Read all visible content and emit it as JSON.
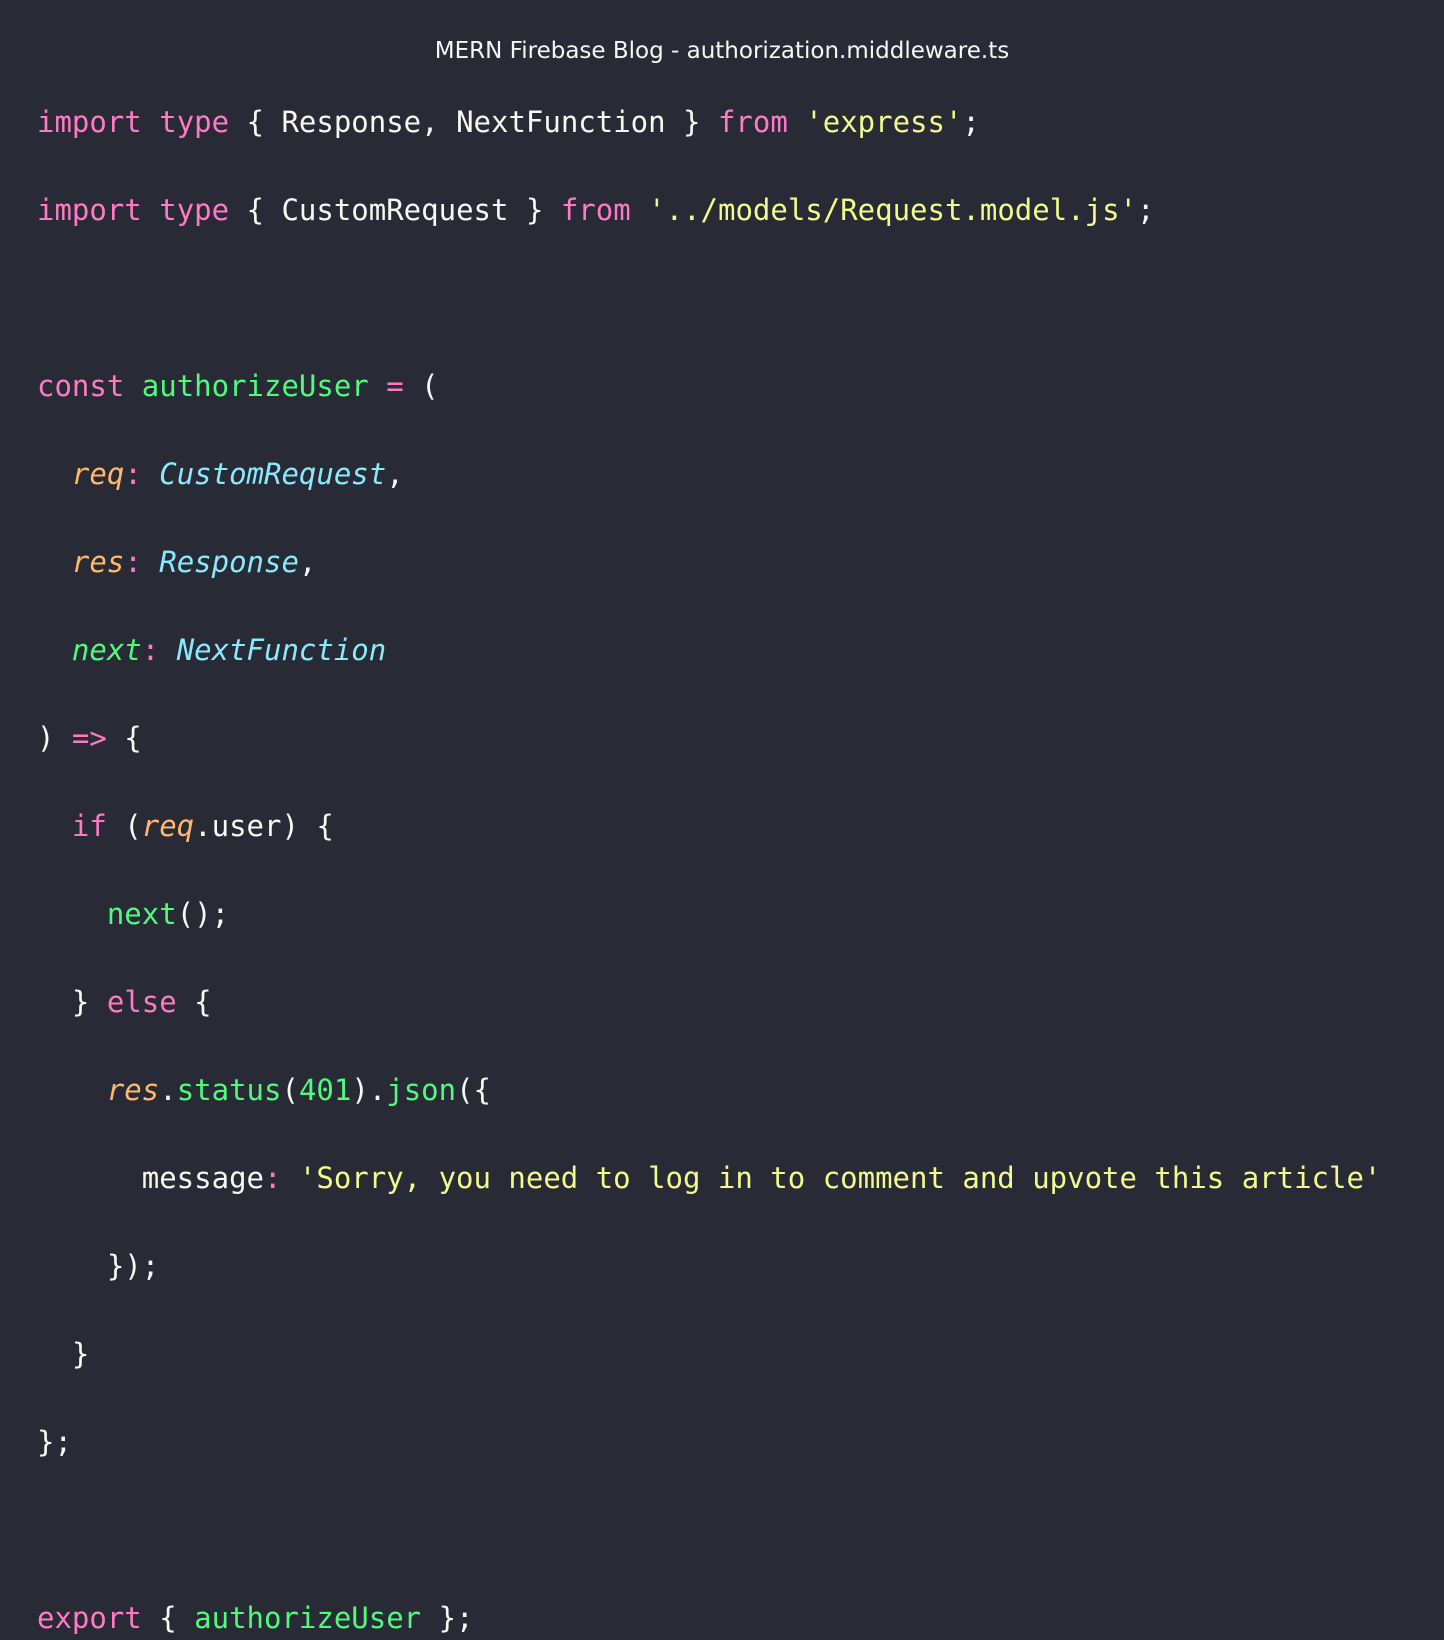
{
  "window": {
    "title": "MERN Firebase Blog - authorization.middleware.ts"
  },
  "colors": {
    "background": "#282a36",
    "keyword": "#ff79c6",
    "string": "#f1fa8c",
    "function": "#50fa7b",
    "parameter": "#ffb86c",
    "type": "#8be9fd",
    "number": "#bd93f9",
    "text": "#f8f8f2"
  },
  "code": {
    "l1": {
      "import": "import",
      "type": "type",
      "open": " { ",
      "names": "Response, NextFunction",
      "close": " } ",
      "from": "from",
      "src": "'express'",
      "end": ";"
    },
    "l2": {
      "import": "import",
      "type": "type",
      "open": " { ",
      "names": "CustomRequest",
      "close": " } ",
      "from": "from",
      "src": "'../models/Request.model.js'",
      "end": ";"
    },
    "l4": {
      "const": "const",
      "name": "authorizeUser",
      "eq": " = ",
      "paren": "("
    },
    "l5": {
      "param": "req",
      "colon": ": ",
      "type": "CustomRequest",
      "comma": ","
    },
    "l6": {
      "param": "res",
      "colon": ": ",
      "type": "Response",
      "comma": ","
    },
    "l7": {
      "param": "next",
      "colon": ": ",
      "type": "NextFunction"
    },
    "l8": {
      "paren": ") ",
      "arrow": "=>",
      "brace": " {"
    },
    "l9": {
      "if": "if",
      "open": " (",
      "obj": "req",
      "prop": ".user) {"
    },
    "l10": {
      "call": "next",
      "rest": "();"
    },
    "l11": {
      "close": "} ",
      "else": "else",
      "brace": " {"
    },
    "l12": {
      "obj": "res",
      "dot": ".",
      "status": "status",
      "open": "(",
      "num": "401",
      "mid": ").",
      "json": "json",
      "rest": "({"
    },
    "l13": {
      "key": "message",
      "colon": ": ",
      "value": "'Sorry, you need to log in to comment and upvote this article'"
    },
    "l14": {
      "text": "});"
    },
    "l15": {
      "text": "}"
    },
    "l16": {
      "text": "};"
    },
    "l18": {
      "export": "export",
      "open": " { ",
      "name": "authorizeUser",
      "close": " };"
    }
  }
}
